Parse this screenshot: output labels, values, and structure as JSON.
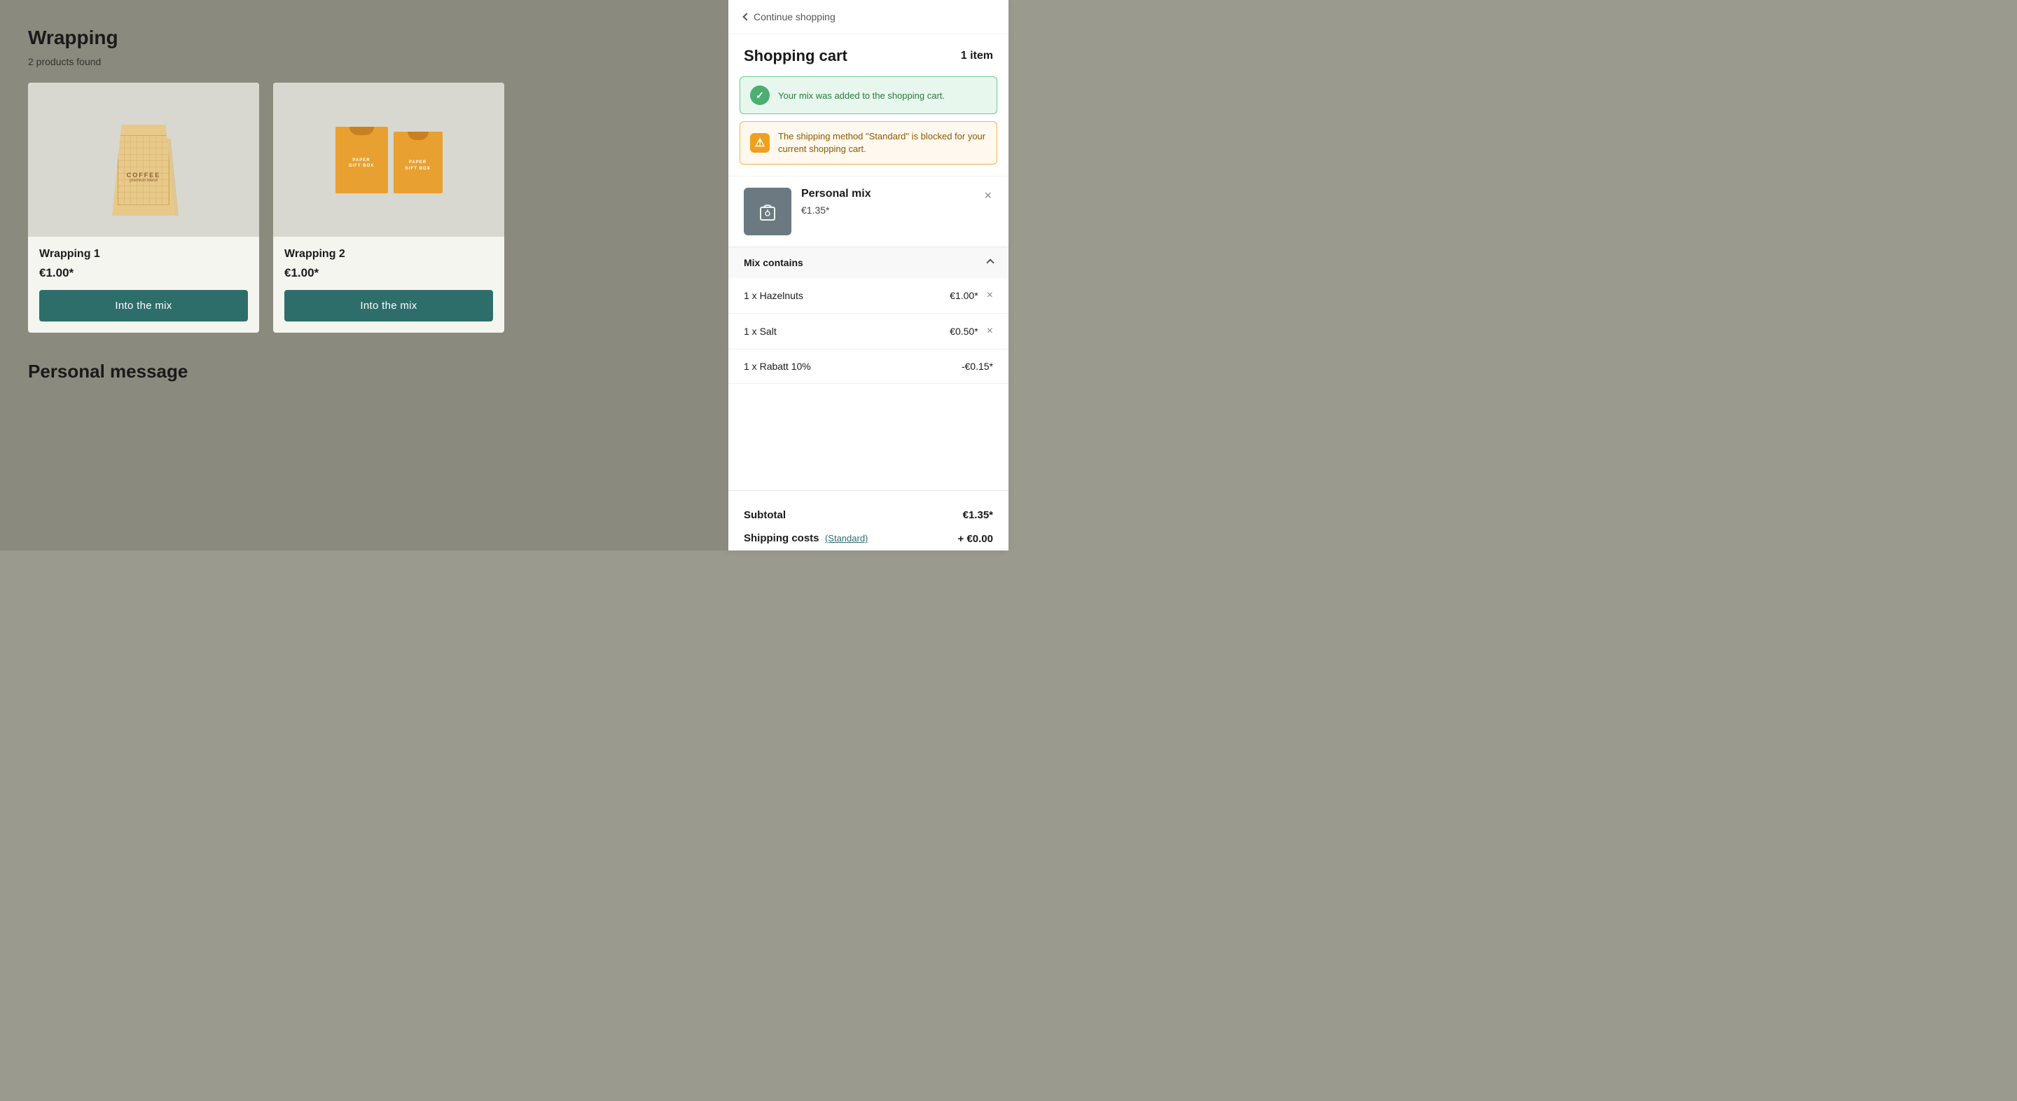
{
  "left_panel": {
    "heading": "Wrapping",
    "products_found": "2 products found",
    "products": [
      {
        "id": "wrapping-1",
        "name": "Wrapping 1",
        "price": "€1.00*",
        "button_label": "Into the mix"
      },
      {
        "id": "wrapping-2",
        "name": "Wrapping 2",
        "price": "€1.00*",
        "button_label": "Into the mix"
      }
    ],
    "personal_message_heading": "Personal message"
  },
  "right_panel": {
    "continue_shopping_label": "Continue shopping",
    "cart_title": "Shopping cart",
    "cart_count": "1 item",
    "success_notification": "Your mix was added to the shopping cart.",
    "warning_notification": "The shipping method \"Standard\" is blocked for your current shopping cart.",
    "cart_item": {
      "name": "Personal mix",
      "price": "€1.35*"
    },
    "mix_contains": {
      "label": "Mix contains",
      "items": [
        {
          "quantity": "1 x",
          "name": "Hazelnuts",
          "price": "€1.00*"
        },
        {
          "quantity": "1 x",
          "name": "Salt",
          "price": "€0.50*"
        },
        {
          "quantity": "1 x",
          "name": "Rabatt 10%",
          "price": "-€0.15*"
        }
      ]
    },
    "subtotal_label": "Subtotal",
    "subtotal_value": "€1.35*",
    "shipping_label": "Shipping costs",
    "shipping_method": "(Standard)",
    "shipping_value": "+ €0.00"
  }
}
